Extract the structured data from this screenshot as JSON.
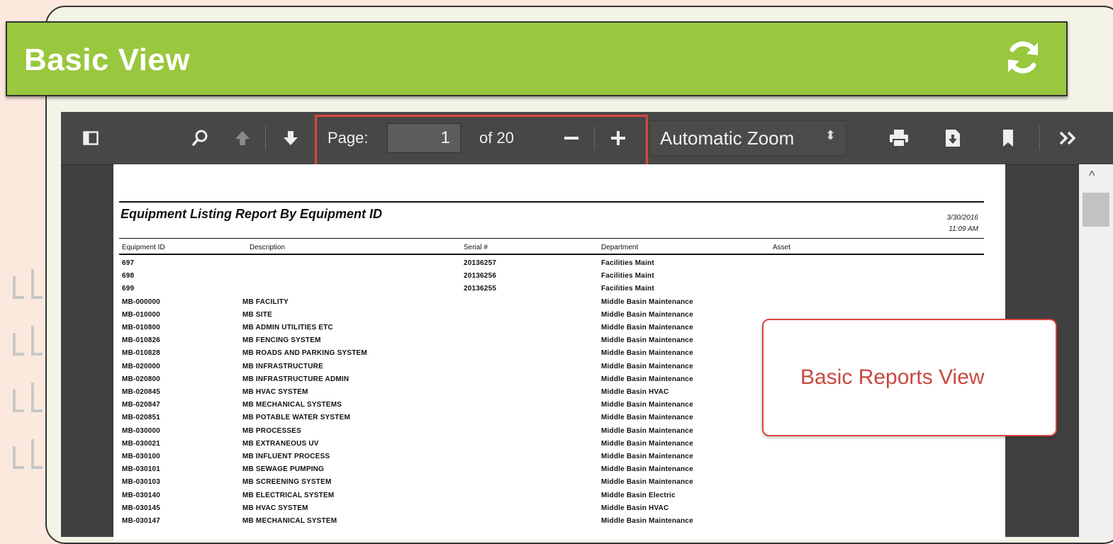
{
  "header": {
    "title": "Basic View"
  },
  "toolbar": {
    "page_label": "Page:",
    "page_value": "1",
    "page_of": "of 20",
    "zoom_value": "Automatic Zoom"
  },
  "report": {
    "title": "Equipment Listing Report By Equipment ID",
    "date": "3/30/2016",
    "time": "11:09 AM",
    "columns": [
      "Equipment ID",
      "Description",
      "Serial #",
      "Department",
      "Asset"
    ],
    "rows": [
      [
        "697",
        "",
        "20136257",
        "Facilities Maint",
        ""
      ],
      [
        "698",
        "",
        "20136256",
        "Facilities Maint",
        ""
      ],
      [
        "699",
        "",
        "20136255",
        "Facilities Maint",
        ""
      ],
      [
        "MB-000000",
        "MB FACILITY",
        "",
        "Middle Basin Maintenance",
        ""
      ],
      [
        "MB-010000",
        "MB SITE",
        "",
        "Middle Basin Maintenance",
        ""
      ],
      [
        "MB-010800",
        "MB ADMIN UTILITIES ETC",
        "",
        "Middle Basin Maintenance",
        ""
      ],
      [
        "MB-010826",
        "MB FENCING SYSTEM",
        "",
        "Middle Basin Maintenance",
        ""
      ],
      [
        "MB-010828",
        "MB ROADS AND PARKING SYSTEM",
        "",
        "Middle Basin Maintenance",
        ""
      ],
      [
        "MB-020000",
        "MB INFRASTRUCTURE",
        "",
        "Middle Basin Maintenance",
        ""
      ],
      [
        "MB-020800",
        "MB INFRASTRUCTURE ADMIN",
        "",
        "Middle Basin Maintenance",
        ""
      ],
      [
        "MB-020845",
        "MB HVAC SYSTEM",
        "",
        "Middle Basin HVAC",
        ""
      ],
      [
        "MB-020847",
        "MB MECHANICAL SYSTEMS",
        "",
        "Middle Basin Maintenance",
        ""
      ],
      [
        "MB-020851",
        "MB POTABLE WATER SYSTEM",
        "",
        "Middle Basin Maintenance",
        ""
      ],
      [
        "MB-030000",
        "MB PROCESSES",
        "",
        "Middle Basin Maintenance",
        ""
      ],
      [
        "MB-030021",
        "MB EXTRANEOUS UV",
        "",
        "Middle Basin Maintenance",
        ""
      ],
      [
        "MB-030100",
        "MB INFLUENT PROCESS",
        "",
        "Middle Basin Maintenance",
        ""
      ],
      [
        "MB-030101",
        "MB SEWAGE PUMPING",
        "",
        "Middle Basin Maintenance",
        ""
      ],
      [
        "MB-030103",
        "MB SCREENING SYSTEM",
        "",
        "Middle Basin Maintenance",
        ""
      ],
      [
        "MB-030140",
        "MB ELECTRICAL SYSTEM",
        "",
        "Middle Basin Electric",
        ""
      ],
      [
        "MB-030145",
        "MB HVAC SYSTEM",
        "",
        "Middle Basin HVAC",
        ""
      ],
      [
        "MB-030147",
        "MB MECHANICAL SYSTEM",
        "",
        "Middle Basin Maintenance",
        ""
      ]
    ]
  },
  "callout": {
    "text": "Basic Reports View"
  },
  "colors": {
    "header_green": "#99c73e",
    "callout_red": "#d9463f",
    "toolbar_dark": "#474747"
  }
}
